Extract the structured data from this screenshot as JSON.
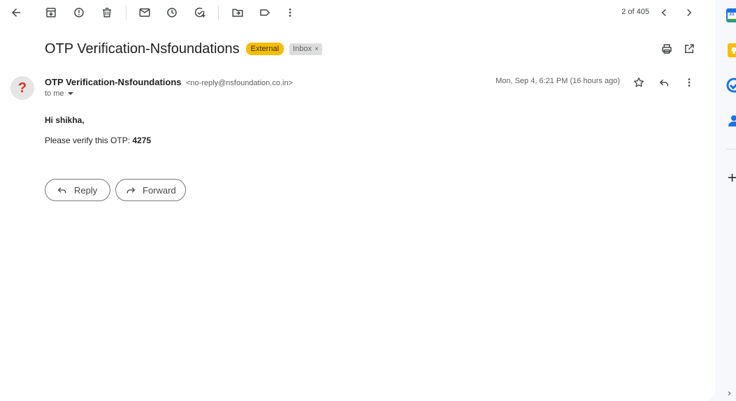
{
  "toolbar": {
    "counter": "2 of 405",
    "icons": [
      "back-arrow-icon",
      "archive-icon",
      "report-spam-icon",
      "delete-icon",
      "mark-unread-icon",
      "snooze-icon",
      "add-task-icon",
      "move-to-icon",
      "label-icon",
      "more-vert-icon",
      "older-chevron-icon",
      "newer-chevron-icon"
    ]
  },
  "subject": {
    "title": "OTP Verification-Nsfoundations",
    "labels": [
      {
        "text": "External",
        "color": "#f5bd00"
      },
      {
        "text": "Inbox",
        "remove": "×"
      }
    ]
  },
  "message": {
    "avatar_glyph": "?",
    "sender_name": "OTP Verification-Nsfoundations",
    "sender_email": "<no-reply@nsfoundation.co.in>",
    "to": "to me",
    "datetime": "Mon, Sep 4, 6:21 PM (16 hours ago)",
    "greeting": "Hi shikha,",
    "body_prefix": "Please verify this OTP: ",
    "otp": "4275"
  },
  "actions": {
    "reply": "Reply",
    "forward": "Forward"
  },
  "side_panel": {
    "calendar_day": "31",
    "items": [
      "calendar-icon",
      "keep-icon",
      "tasks-icon",
      "contacts-icon",
      "add-icon",
      "expand-chevron-icon"
    ],
    "plus": "+",
    "chevron": "›"
  },
  "colors": {
    "external_label": "#f5bd00",
    "avatar_question": "#d93025",
    "calendar_blue": "#1a73e8",
    "keep_yellow": "#fbbc04"
  }
}
